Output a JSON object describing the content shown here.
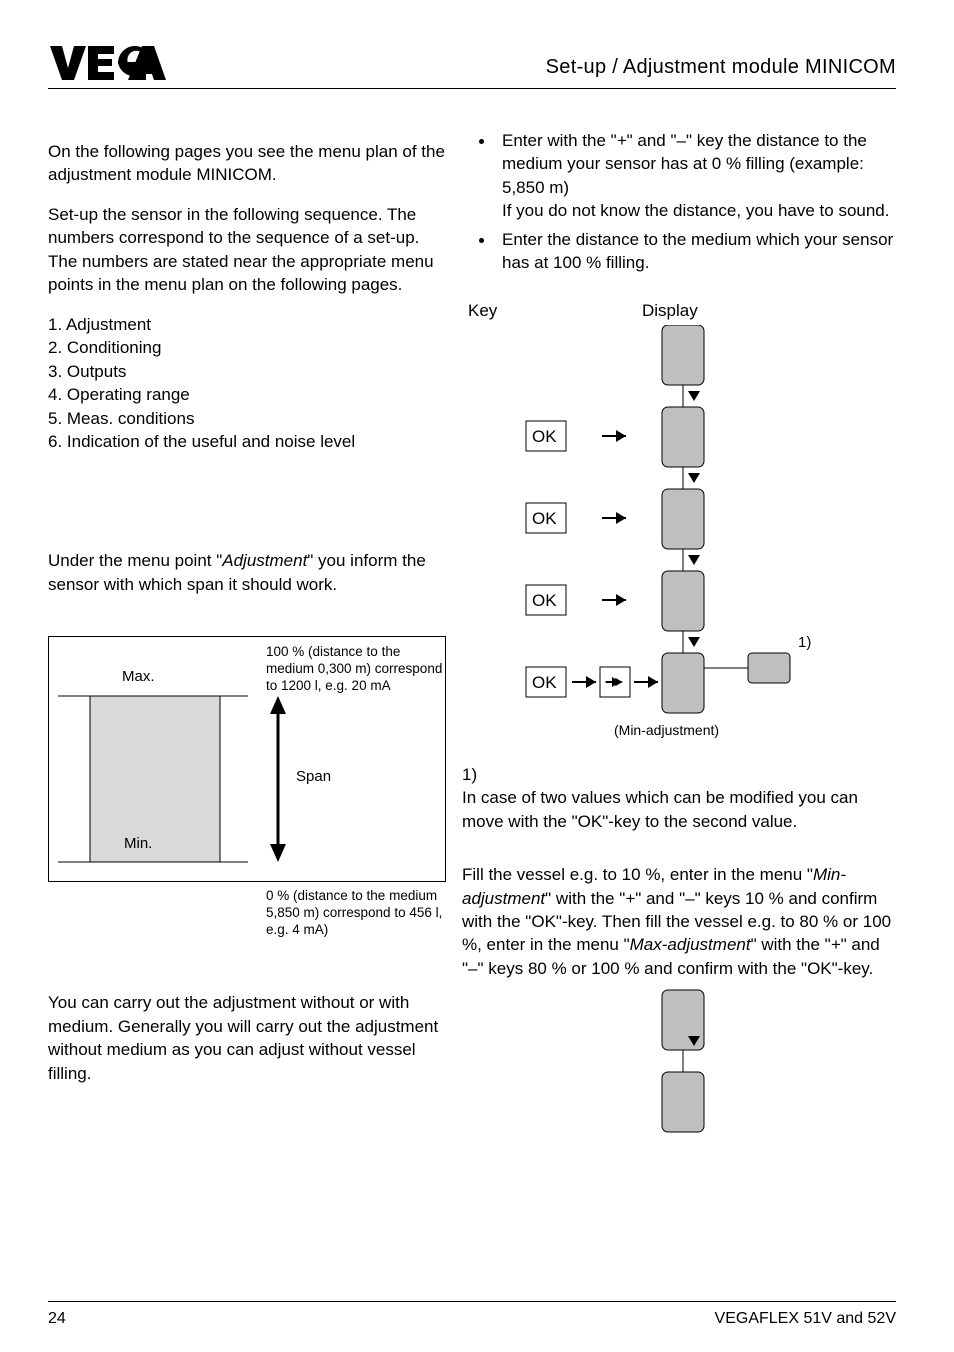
{
  "header": {
    "title": "Set-up / Adjustment module MINICOM"
  },
  "left": {
    "intro1": "On the following pages you see the menu plan of the adjustment module MINICOM.",
    "intro2": "Set-up the sensor in the following sequence. The numbers correspond to the sequence of a set-up. The numbers are stated near the appropriate menu points in the menu plan on the following pages.",
    "seq1": "1. Adjustment",
    "seq2": "2. Conditioning",
    "seq3": "3. Outputs",
    "seq4": "4. Operating range",
    "seq5": "5. Meas. conditions",
    "seq6": "6. Indication of the useful and noise level",
    "adj_pre": "Under the menu point \"",
    "adj_ital": "Adjustment",
    "adj_post": "\" you inform the sensor with which span it should work.",
    "diag": {
      "max": "Max.",
      "min": "Min.",
      "span": "Span",
      "top_note": "100 % (distance to the medium 0,300 m) correspond to 1200 l, e.g. 20 mA",
      "bottom_note": "0 % (distance to the medium 5,850 m) correspond to 456 l, e.g. 4 mA)"
    },
    "carryout": "You can carry out the adjustment without or with medium. Generally you will carry out the adjustment without medium as you can adjust without vessel filling."
  },
  "right": {
    "bullet1_a": "Enter with the \"",
    "bullet1_plus": "+",
    "bullet1_b": "\" and \"",
    "bullet1_minus": "–",
    "bullet1_c": "\" key the distance to the medium your sensor has at 0 % filling (example: 5,850 m)",
    "bullet1_d": "If you do not know the distance, you have to sound.",
    "bullet2": "Enter the distance to the medium which your sensor has at 100 % filling.",
    "key": "Key",
    "display": "Display",
    "ok": "OK",
    "one_paren": "1)",
    "min_adj": "(Min-adjustment)",
    "note1_num": "1)",
    "note1_body": "In case of two values which can be modified you can move with the \"OK\"-key to the second value.",
    "fill_a": "Fill the vessel e.g. to 10 %, enter in the menu \"",
    "fill_minadj": "Min-adjustment",
    "fill_b": "\" with the \"",
    "fill_plus1": "+",
    "fill_c": "\" and \"",
    "fill_minus1": "–",
    "fill_d": "\" keys 10 % and confirm with the \"OK\"-key. Then fill the vessel e.g. to 80 % or 100 %, enter in the menu \"",
    "fill_maxadj": "Max-adjustment",
    "fill_e": "\" with the \"",
    "fill_plus2": "+",
    "fill_f": "\" and \"",
    "fill_minus2": "–",
    "fill_g": "\" keys 80 % or 100 % and confirm with the \"OK\"-key."
  },
  "footer": {
    "page": "24",
    "docref": "VEGAFLEX 51V and 52V"
  }
}
